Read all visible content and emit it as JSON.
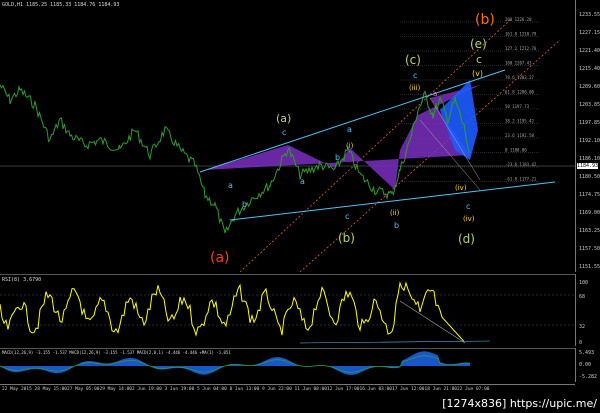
{
  "chart_header": "GOLD,H1  1185.25 1185.33 1184.76 1184.93",
  "price_scale": [
    "1233.55",
    "1227.15",
    "1221.40",
    "1215.40",
    "1209.60",
    "1203.85",
    "1197.85",
    "1192.10",
    "1186.10",
    "1180.50",
    "1174.75",
    "1169.00",
    "1163.25",
    "1157.50",
    "1151.55"
  ],
  "current_price": "1184.93",
  "wave_labels": {
    "b_major": "(b)",
    "e_major": "(e)",
    "c_top": "c",
    "c_paren": "(c)",
    "v_paren": "(v)",
    "a_major": "(a)",
    "a_paren": "(a)",
    "b_paren": "(b)",
    "d_paren": "(d)",
    "iii_paren": "(iii)",
    "i_paren": "(i)",
    "ii_paren": "(ii)",
    "iv_paren": "(iv)",
    "a1": "a",
    "b1": "b",
    "c1": "c",
    "a2": "a",
    "b2": "b",
    "c2": "c",
    "a3": "a",
    "b3": "b",
    "c3": "c",
    "a4": "a",
    "a_pink": "a",
    "b_pink": "b",
    "c_d": "c"
  },
  "fib_levels": [
    "200  1226.20",
    "161.8  1218.79",
    "127.2  1212.76",
    "100  1207.43",
    "78.6  1203.27",
    "61.8  1200.00",
    "50  1197.73",
    "38.2  1195.42",
    "23.6  1192.58",
    "0  1188.00",
    "-23.6  1183.42",
    "-61.8  1177.21"
  ],
  "rsi": {
    "header": "RSI(8) 3.6790",
    "scale": [
      "100",
      "68",
      "32",
      "0"
    ]
  },
  "macd": {
    "header": "MACD(12,26,9) -3.155 -1.537  MACD(12,26,9) -3.155 -1.537  MACD(2,8,1) -4.446 -4.446  +MA(1) -1.051",
    "scale": [
      "5.493",
      "0.00",
      "-5.282"
    ]
  },
  "time_axis": [
    "22 May 2015",
    "28 May 15:00",
    "27 May 05:00",
    "29 May 14:00",
    "2 Jun 19:00",
    "3 Jun 19:00",
    "5 Jun 04:00",
    "8 Jun 13:00",
    "9 Jun 22:00",
    "11 Jun 08:00",
    "12 Jun 17:00",
    "16 Jun 03:00",
    "17 Jun 12:00",
    "18 Jun 21:00",
    "22 Jun 07:00"
  ],
  "watermark": "[1274x836] https://upic.me/",
  "colors": {
    "price_line": "#2e9d2e",
    "channel": "#4fc3f7",
    "pattern_fill": "#7b2fbf",
    "target_fill": "#1e5bff",
    "rsi_line": "#ffff00",
    "label_yellow_green": "#b5d26a",
    "label_orange": "#ff6a1a",
    "label_cyan": "#4fc3f7"
  }
}
